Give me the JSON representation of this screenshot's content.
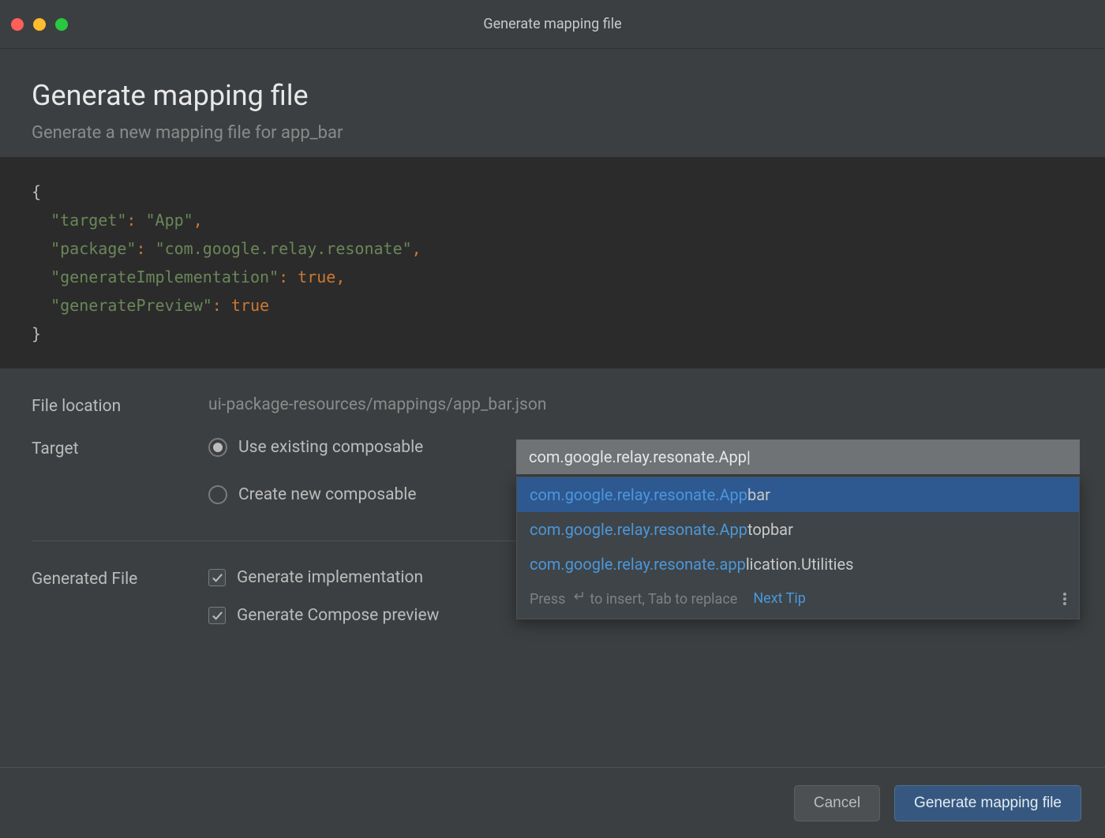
{
  "window": {
    "title": "Generate mapping file"
  },
  "header": {
    "title": "Generate mapping file",
    "subtitle": "Generate a new mapping file for app_bar"
  },
  "code": {
    "target_key": "\"target\"",
    "target_val": "\"App\"",
    "package_key": "\"package\"",
    "package_val": "\"com.google.relay.resonate\"",
    "genimpl_key": "\"generateImplementation\"",
    "genprev_key": "\"generatePreview\"",
    "true_literal": "true"
  },
  "form": {
    "file_location_label": "File location",
    "file_location_value": "ui-package-resources/mappings/app_bar.json",
    "target_label": "Target",
    "radio_existing": "Use existing composable",
    "radio_create": "Create new composable",
    "generated_file_label": "Generated File",
    "cb_genimpl": "Generate implementation",
    "cb_genprev": "Generate Compose preview"
  },
  "target_input": {
    "value": "com.google.relay.resonate.App|"
  },
  "autocomplete": {
    "items": [
      {
        "match": "com.google.relay.resonate.App",
        "rest": "bar"
      },
      {
        "match": "com.google.relay.resonate.App",
        "rest": "topbar"
      },
      {
        "match": "com.google.relay.resonate.app",
        "rest": "lication.Utilities"
      }
    ],
    "hint_a": "Press ",
    "hint_b": " to insert, Tab to replace",
    "next_tip": "Next Tip"
  },
  "footer": {
    "cancel": "Cancel",
    "ok": "Generate mapping file"
  }
}
